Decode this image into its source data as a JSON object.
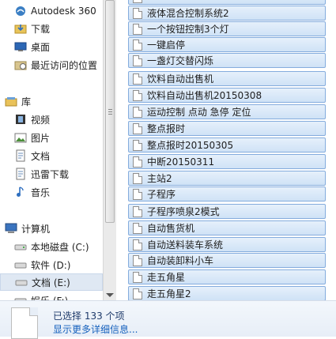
{
  "nav": {
    "items": [
      {
        "label": "Autodesk 360",
        "icon": "cloud-icon"
      },
      {
        "label": "下载",
        "icon": "download-folder-icon"
      },
      {
        "label": "桌面",
        "icon": "desktop-icon"
      },
      {
        "label": "最近访问的位置",
        "icon": "recent-places-icon"
      },
      {
        "label": "库",
        "icon": "library-icon"
      },
      {
        "label": "视频",
        "icon": "video-library-icon"
      },
      {
        "label": "图片",
        "icon": "pictures-library-icon"
      },
      {
        "label": "文档",
        "icon": "documents-library-icon"
      },
      {
        "label": "迅雷下载",
        "icon": "thunder-download-icon"
      },
      {
        "label": "音乐",
        "icon": "music-library-icon"
      },
      {
        "label": "计算机",
        "icon": "computer-icon"
      },
      {
        "label": "本地磁盘 (C:)",
        "icon": "drive-icon"
      },
      {
        "label": "软件 (D:)",
        "icon": "drive-icon"
      },
      {
        "label": "文档 (E:)",
        "icon": "drive-icon"
      },
      {
        "label": "娱乐 (F:)",
        "icon": "drive-icon"
      }
    ]
  },
  "files": [
    "液体混合控制系统2",
    "一个按钮控制3个灯",
    "一键启停",
    "一盏灯交替闪烁",
    "饮料自动出售机",
    "饮料自动出售机20150308",
    "运动控制 点动 急停 定位",
    "整点报时",
    "整点报时20150305",
    "中断20150311",
    "主站2",
    "子程序",
    "子程序喷泉2模式",
    "自动售货机",
    "自动送料装车系统",
    "自动装卸料小车",
    "走五角星",
    "走五角星2"
  ],
  "status": {
    "selected": "已选择 133 个项",
    "details_link": "显示更多详细信息..."
  },
  "colors": {
    "selection_fill": "#cfe2f6",
    "selection_border": "#84acdd",
    "link": "#1560bd"
  }
}
